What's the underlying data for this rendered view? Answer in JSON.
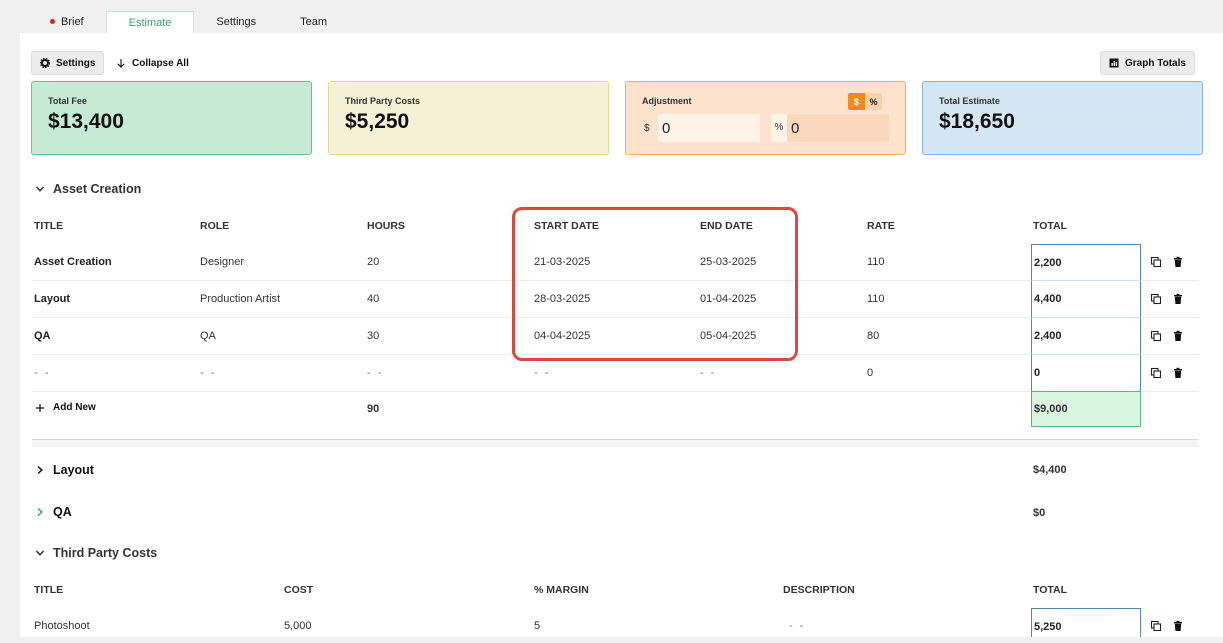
{
  "tabs": [
    "Brief",
    "Estimate",
    "Settings",
    "Team"
  ],
  "toolbar": {
    "settings": "Settings",
    "collapse_all": "Collapse All",
    "graph_totals": "Graph Totals"
  },
  "cards": {
    "total_fee": {
      "label": "Total Fee",
      "value": "$13,400"
    },
    "third_party": {
      "label": "Third Party Costs",
      "value": "$5,250"
    },
    "adjustment": {
      "label": "Adjustment",
      "toggle_dollar": "$",
      "toggle_percent": "%",
      "dollar_symbol": "$",
      "dollar_value": "0",
      "percent_symbol": "%",
      "percent_value": "0"
    },
    "total_estimate": {
      "label": "Total Estimate",
      "value": "$18,650"
    }
  },
  "asset_creation": {
    "title": "Asset Creation",
    "headers": {
      "title": "TITLE",
      "role": "ROLE",
      "hours": "HOURS",
      "start": "START DATE",
      "end": "END DATE",
      "rate": "RATE",
      "total": "TOTAL"
    },
    "rows": [
      {
        "title": "Asset Creation",
        "role": "Designer",
        "hours": "20",
        "start": "21-03-2025",
        "end": "25-03-2025",
        "rate": "110",
        "total": "2,200"
      },
      {
        "title": "Layout",
        "role": "Production Artist",
        "hours": "40",
        "start": "28-03-2025",
        "end": "01-04-2025",
        "rate": "110",
        "total": "4,400"
      },
      {
        "title": "QA",
        "role": "QA",
        "hours": "30",
        "start": "04-04-2025",
        "end": "05-04-2025",
        "rate": "80",
        "total": "2,400"
      },
      {
        "title": "- -",
        "role": "- -",
        "hours": "- -",
        "start": "- -",
        "end": "- -",
        "rate": "0",
        "total": "0"
      }
    ],
    "add_new": "Add New",
    "sum_hours": "90",
    "sum_total": "$9,000"
  },
  "layout_section": {
    "title": "Layout",
    "total": "$4,400"
  },
  "qa_section": {
    "title": "QA",
    "total": "$0"
  },
  "third_party": {
    "title": "Third Party Costs",
    "headers": {
      "title": "TITLE",
      "cost": "COST",
      "margin": "% MARGIN",
      "description": "DESCRIPTION",
      "total": "TOTAL"
    },
    "rows": [
      {
        "title": "Photoshoot",
        "cost": "5,000",
        "margin": "5",
        "description": "- -",
        "total": "5,250"
      }
    ]
  },
  "colors": {
    "accent_green": "#3a9e6e",
    "highlight_red": "#d74a3c",
    "adjust_orange": "#f28c18"
  }
}
